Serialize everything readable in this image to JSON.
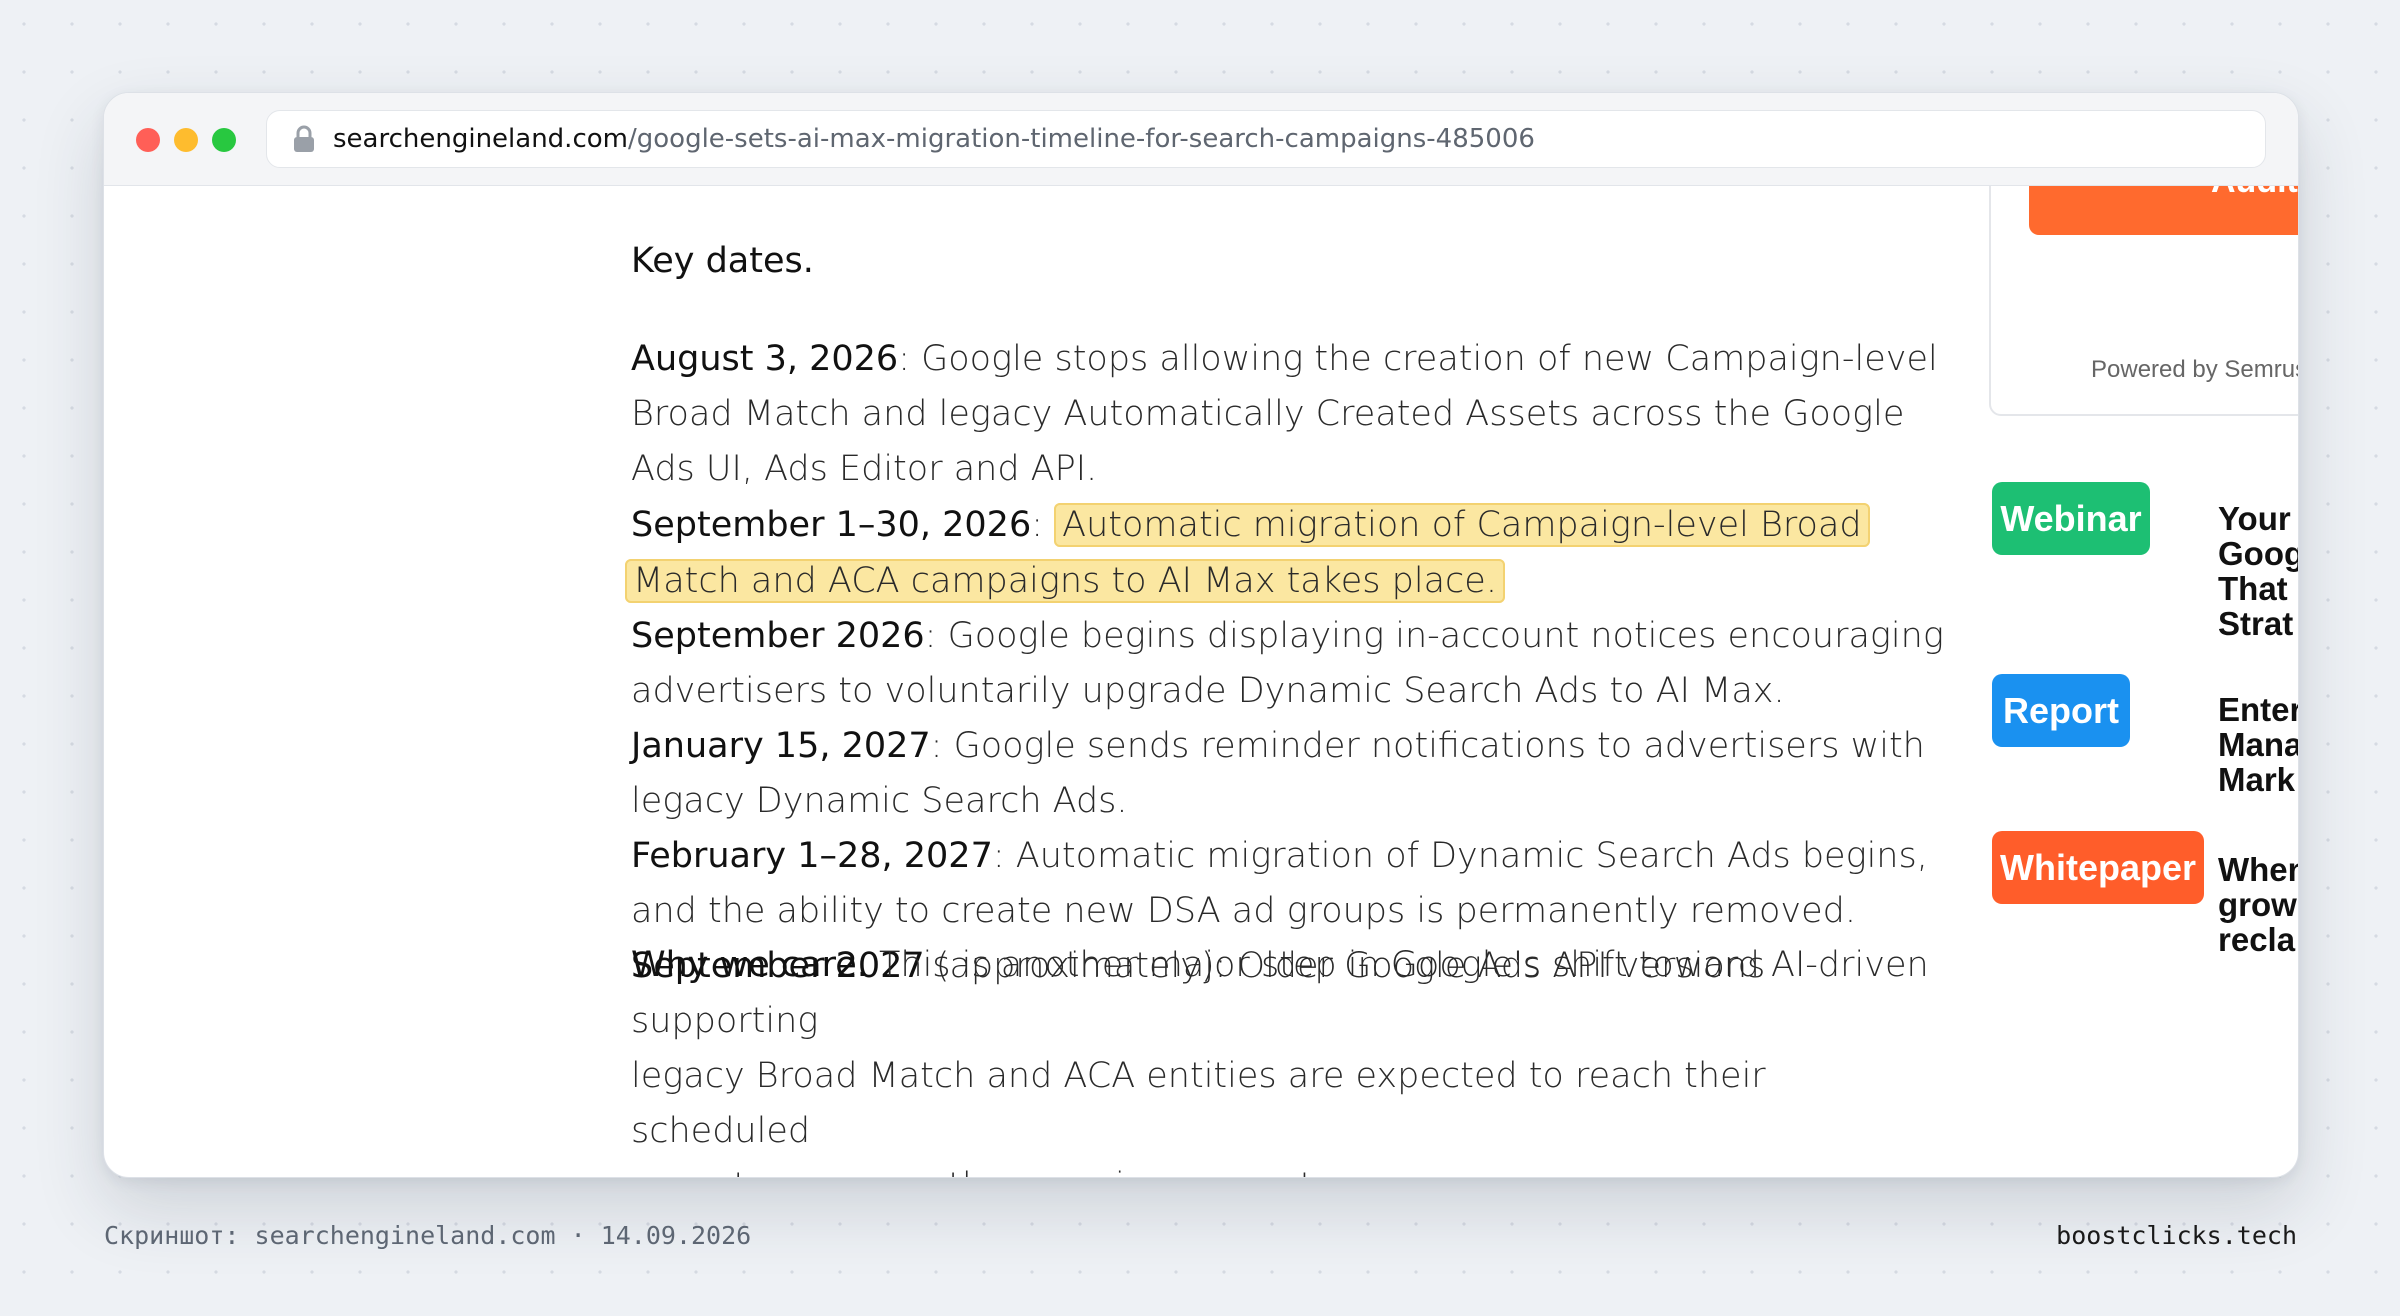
{
  "browser": {
    "url_domain": "searchengineland.com",
    "url_path": "/google-sets-ai-max-migration-timeline-for-search-campaigns-485006"
  },
  "article": {
    "heading": "Key dates",
    "heading_period": ".",
    "items": [
      {
        "date": "August 3, 2026",
        "sep": ": ",
        "lines": [
          "Google stops allowing the creation of new Campaign-level",
          "Broad Match and legacy Automatically Created Assets across the Google",
          "Ads UI, Ads Editor and API."
        ]
      },
      {
        "date": "September 1–30, 2026",
        "sep": ": ",
        "highlight_lines": [
          "Automatic migration of Campaign-level Broad",
          "Match and ACA campaigns to AI Max takes place."
        ]
      },
      {
        "date": "September 2026",
        "sep": ": ",
        "lines": [
          "Google begins displaying in-account notices encouraging",
          "advertisers to voluntarily upgrade Dynamic Search Ads to AI Max."
        ]
      },
      {
        "date": "January 15, 2027",
        "sep": ": ",
        "lines": [
          "Google sends reminder notifications to advertisers with",
          "legacy Dynamic Search Ads."
        ]
      },
      {
        "date": "February 1–28, 2027",
        "sep": ": ",
        "lines": [
          "Automatic migration of Dynamic Search Ads begins,",
          "and the ability to create new DSA ad groups is permanently removed."
        ]
      },
      {
        "date": "September 2027",
        "sep": " ",
        "lines": [
          "(approximately): Older Google Ads API versions supporting",
          "legacy Broad Match and ACA entities are expected to reach their scheduled",
          "sunset, permanently removing support."
        ]
      }
    ],
    "cut_bold": "Why we care.",
    "cut_text": " This is another major step in Google's shift toward AI-driven"
  },
  "sidebar": {
    "button_text": "Audit",
    "powered_by": "Powered by Semrush",
    "promos": [
      {
        "tag": "Webinar",
        "color": "#1dbf73",
        "lines": [
          "Your",
          "Goog",
          "That",
          "Strat"
        ]
      },
      {
        "tag": "Report",
        "color": "#1a91f0",
        "lines": [
          "Enter",
          "Mana",
          "Mark"
        ]
      },
      {
        "tag": "Whitepaper",
        "color": "#ff5d2a",
        "lines": [
          "When",
          "grow",
          "recla"
        ]
      }
    ]
  },
  "footer": {
    "left": "Скриншот: searchengineland.com · 14.09.2026",
    "right": "boostclicks.tech"
  }
}
